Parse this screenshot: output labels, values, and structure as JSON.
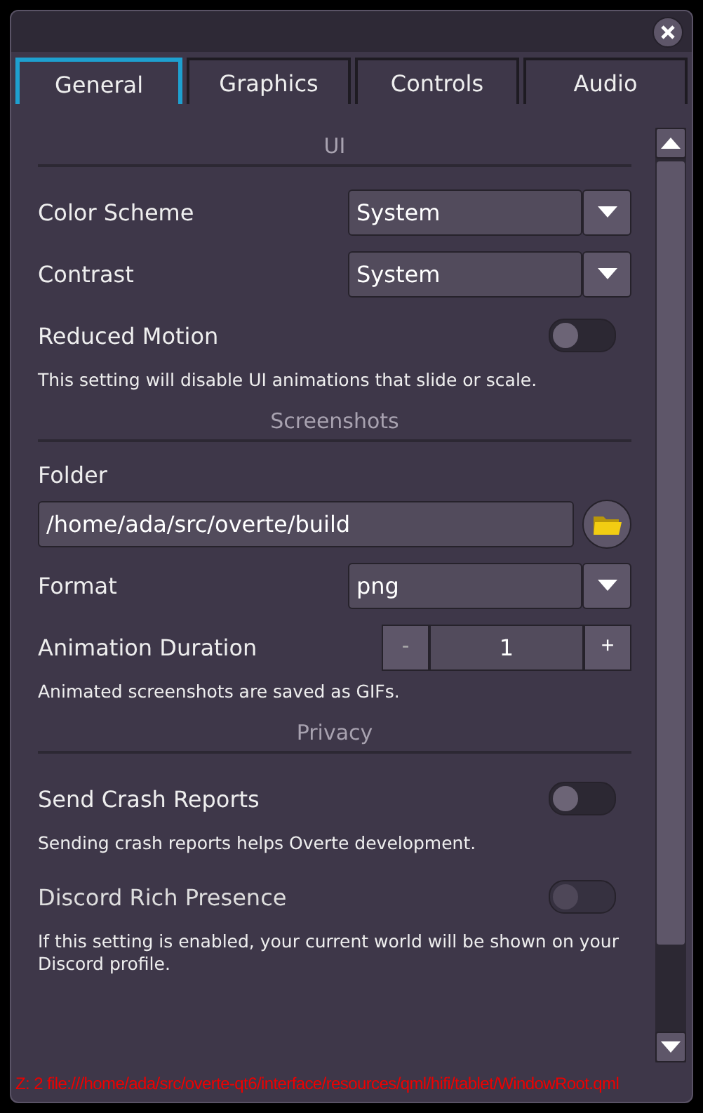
{
  "tabs": [
    {
      "label": "General",
      "selected": true
    },
    {
      "label": "Graphics",
      "selected": false
    },
    {
      "label": "Controls",
      "selected": false
    },
    {
      "label": "Audio",
      "selected": false
    }
  ],
  "sections": [
    {
      "title": "UI",
      "items": [
        {
          "kind": "dropdown",
          "label": "Color Scheme",
          "value": "System"
        },
        {
          "kind": "dropdown",
          "label": "Contrast",
          "value": "System"
        },
        {
          "kind": "toggle",
          "label": "Reduced Motion",
          "on": false,
          "disabled": false
        },
        {
          "kind": "note",
          "text": "This setting will disable UI animations that slide or scale."
        }
      ]
    },
    {
      "title": "Screenshots",
      "items": [
        {
          "kind": "label",
          "label": "Folder"
        },
        {
          "kind": "path",
          "value": "/home/ada/src/overte/build"
        },
        {
          "kind": "dropdown",
          "label": "Format",
          "value": "png"
        },
        {
          "kind": "spinbox",
          "label": "Animation Duration",
          "value": "1",
          "minus": "-",
          "plus": "+"
        },
        {
          "kind": "note",
          "text": "Animated screenshots are saved as GIFs."
        }
      ]
    },
    {
      "title": "Privacy",
      "items": [
        {
          "kind": "toggle",
          "label": "Send Crash Reports",
          "on": false,
          "disabled": false
        },
        {
          "kind": "note",
          "text": "Sending crash reports helps Overte development."
        },
        {
          "kind": "toggle",
          "label": "Discord Rich Presence",
          "on": false,
          "disabled": true
        },
        {
          "kind": "note",
          "text": "If this setting is enabled, your current world will be shown on your Discord profile."
        }
      ]
    }
  ],
  "debug_text": "Z: 2 file:///home/ada/src/overte-qt6/interface/resources/qml/hifi/tablet/WindowRoot.qml"
}
